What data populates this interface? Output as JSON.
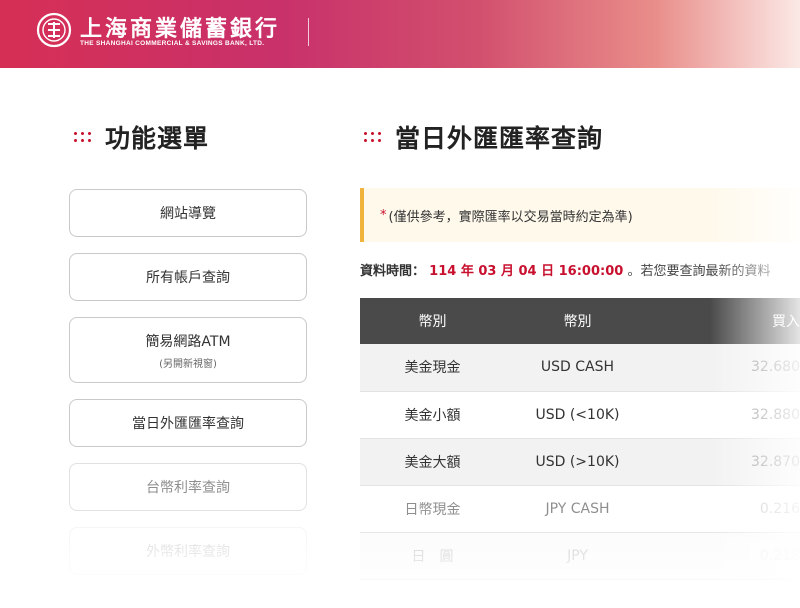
{
  "header": {
    "brand_cn": "上海商業儲蓄銀行",
    "brand_en": "THE SHANGHAI COMMERCIAL & SAVINGS BANK, LTD.",
    "logo_icon": "bank-seal-icon"
  },
  "sidebar": {
    "title": "功能選單",
    "items": [
      {
        "label": "網站導覽"
      },
      {
        "label": "所有帳戶查詢"
      },
      {
        "label": "簡易網路ATM",
        "sub": "(另開新視窗)"
      },
      {
        "label": "當日外匯匯率查詢"
      },
      {
        "label": "台幣利率查詢"
      },
      {
        "label": "外幣利率查詢"
      }
    ]
  },
  "main": {
    "title": "當日外匯匯率查詢",
    "notice_star": "*",
    "notice": "(僅供參考，實際匯率以交易當時約定為準)",
    "data_time_label": "資料時間：",
    "data_time_value": "114 年 03 月 04 日 16:00:00",
    "data_time_note": "。若您要查詢最新的資料",
    "table": {
      "headers": [
        "幣別",
        "幣別",
        "買入"
      ],
      "rows": [
        [
          "美金現金",
          "USD CASH",
          "32.680"
        ],
        [
          "美金小額",
          "USD (<10K)",
          "32.880"
        ],
        [
          "美金大額",
          "USD (>10K)",
          "32.870"
        ],
        [
          "日幣現金",
          "JPY CASH",
          "0.216"
        ],
        [
          "日　圓",
          "JPY",
          "0.218"
        ]
      ]
    }
  },
  "colors": {
    "accent_red": "#c8102e",
    "header_gradient_start": "#d62f55",
    "table_header": "#4a4a4a",
    "notice_border": "#f0b33c"
  }
}
